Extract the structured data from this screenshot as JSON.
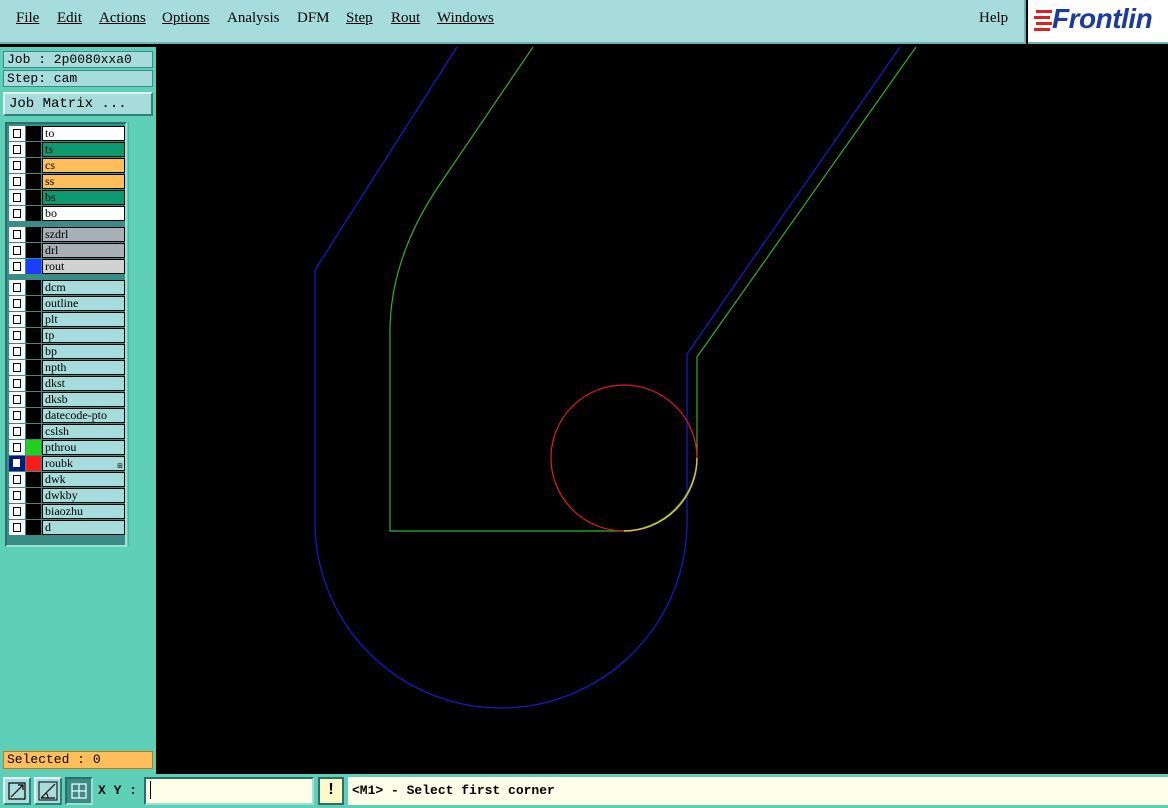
{
  "menubar": {
    "items": [
      {
        "label": "File"
      },
      {
        "label": "Edit"
      },
      {
        "label": "Actions"
      },
      {
        "label": "Options"
      },
      {
        "label": "Analysis"
      },
      {
        "label": "DFM"
      },
      {
        "label": "Step"
      },
      {
        "label": "Rout"
      },
      {
        "label": "Windows"
      }
    ],
    "help_label": "Help"
  },
  "logo": {
    "text": "Frontlin",
    "color": "#1c3c9c",
    "accent": "#e02020"
  },
  "panel": {
    "job": "Job : 2p0080xxa0",
    "step": "Step: cam",
    "job_matrix_label": "Job Matrix ...",
    "selected": "Selected : 0"
  },
  "layers": {
    "items": [
      {
        "name": "to",
        "bg": "#ffffff",
        "swatch": "#000000",
        "selected": false
      },
      {
        "name": "ts",
        "bg": "#0e9a70",
        "swatch": "#000000",
        "selected": false
      },
      {
        "name": "cs",
        "bg": "#ffbe5a",
        "swatch": "#000000",
        "selected": false
      },
      {
        "name": "ss",
        "bg": "#ffbe5a",
        "swatch": "#000000",
        "selected": false
      },
      {
        "name": "bs",
        "bg": "#0e9a70",
        "swatch": "#000000",
        "selected": false
      },
      {
        "name": "bo",
        "bg": "#ffffff",
        "swatch": "#000000",
        "selected": false
      },
      {
        "name": "szdrl",
        "bg": "#a8b0b6",
        "swatch": "#000000",
        "selected": false
      },
      {
        "name": "drl",
        "bg": "#a8b0b6",
        "swatch": "#000000",
        "selected": false
      },
      {
        "name": "rout",
        "bg": "#d2d2d2",
        "swatch": "#1a3cff",
        "selected": false
      },
      {
        "name": "dcm",
        "bg": "#a7dcdc",
        "swatch": "#000000",
        "selected": false
      },
      {
        "name": "outline",
        "bg": "#a7dcdc",
        "swatch": "#000000",
        "selected": false
      },
      {
        "name": "plt",
        "bg": "#a7dcdc",
        "swatch": "#000000",
        "selected": false
      },
      {
        "name": "tp",
        "bg": "#a7dcdc",
        "swatch": "#000000",
        "selected": false
      },
      {
        "name": "bp",
        "bg": "#a7dcdc",
        "swatch": "#000000",
        "selected": false
      },
      {
        "name": "npth",
        "bg": "#a7dcdc",
        "swatch": "#000000",
        "selected": false
      },
      {
        "name": "dkst",
        "bg": "#a7dcdc",
        "swatch": "#000000",
        "selected": false
      },
      {
        "name": "dksb",
        "bg": "#a7dcdc",
        "swatch": "#000000",
        "selected": false
      },
      {
        "name": "datecode-pto",
        "bg": "#a7dcdc",
        "swatch": "#000000",
        "selected": false
      },
      {
        "name": "cslsh",
        "bg": "#a7dcdc",
        "swatch": "#000000",
        "selected": false
      },
      {
        "name": "pthrou",
        "bg": "#a7dcdc",
        "swatch": "#1fd01f",
        "selected": false
      },
      {
        "name": "roubk",
        "bg": "#a7dcdc",
        "swatch": "#ff1a1a",
        "selected": true
      },
      {
        "name": "dwk",
        "bg": "#a7dcdc",
        "swatch": "#000000",
        "selected": false
      },
      {
        "name": "dwkby",
        "bg": "#a7dcdc",
        "swatch": "#000000",
        "selected": false
      },
      {
        "name": "biaozhu",
        "bg": "#a7dcdc",
        "swatch": "#000000",
        "selected": false
      },
      {
        "name": "d",
        "bg": "#a7dcdc",
        "swatch": "#000000",
        "selected": false
      }
    ]
  },
  "canvas": {
    "colors": {
      "blue": "#1a1ad6",
      "green": "#2fb02f",
      "red": "#e02020",
      "yellow": "#e0c040"
    }
  },
  "bottombar": {
    "tools": [
      {
        "icon": "zoom-area-icon"
      },
      {
        "icon": "measure-angle-icon"
      },
      {
        "icon": "snap-grid-icon"
      }
    ],
    "xy_label": "X Y :",
    "xy_value": "",
    "bang_label": "!",
    "status_text": "<M1> - Select first corner"
  }
}
